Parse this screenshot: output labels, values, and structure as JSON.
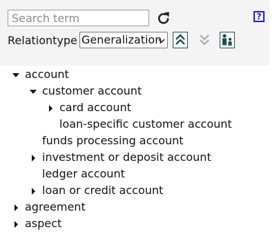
{
  "search": {
    "placeholder": "Search term",
    "value": ""
  },
  "toolbar": {
    "relationtype_label": "Relationtype",
    "relationtype_value": "Generalization",
    "help_label": "?",
    "icons": {
      "refresh": "refresh-icon",
      "expand_up": "double-chevron-up-icon",
      "expand_down": "double-chevron-down-icon",
      "people": "people-icon",
      "help": "help-icon"
    }
  },
  "colors": {
    "help": "#1c1cd6",
    "toolbar_button_border": "#1f4d4d",
    "toolbar_bg": "#f4f4f4"
  },
  "tree": {
    "nodes": [
      {
        "label": "account",
        "state": "expanded"
      },
      {
        "label": "customer account",
        "state": "expanded"
      },
      {
        "label": "card account",
        "state": "collapsed"
      },
      {
        "label": "loan-specific customer account",
        "state": "leaf"
      },
      {
        "label": "funds processing account",
        "state": "leaf"
      },
      {
        "label": "investment or deposit account",
        "state": "collapsed"
      },
      {
        "label": "ledger account",
        "state": "leaf"
      },
      {
        "label": "loan or credit account",
        "state": "collapsed"
      },
      {
        "label": "agreement",
        "state": "collapsed"
      },
      {
        "label": "aspect",
        "state": "collapsed"
      }
    ]
  }
}
